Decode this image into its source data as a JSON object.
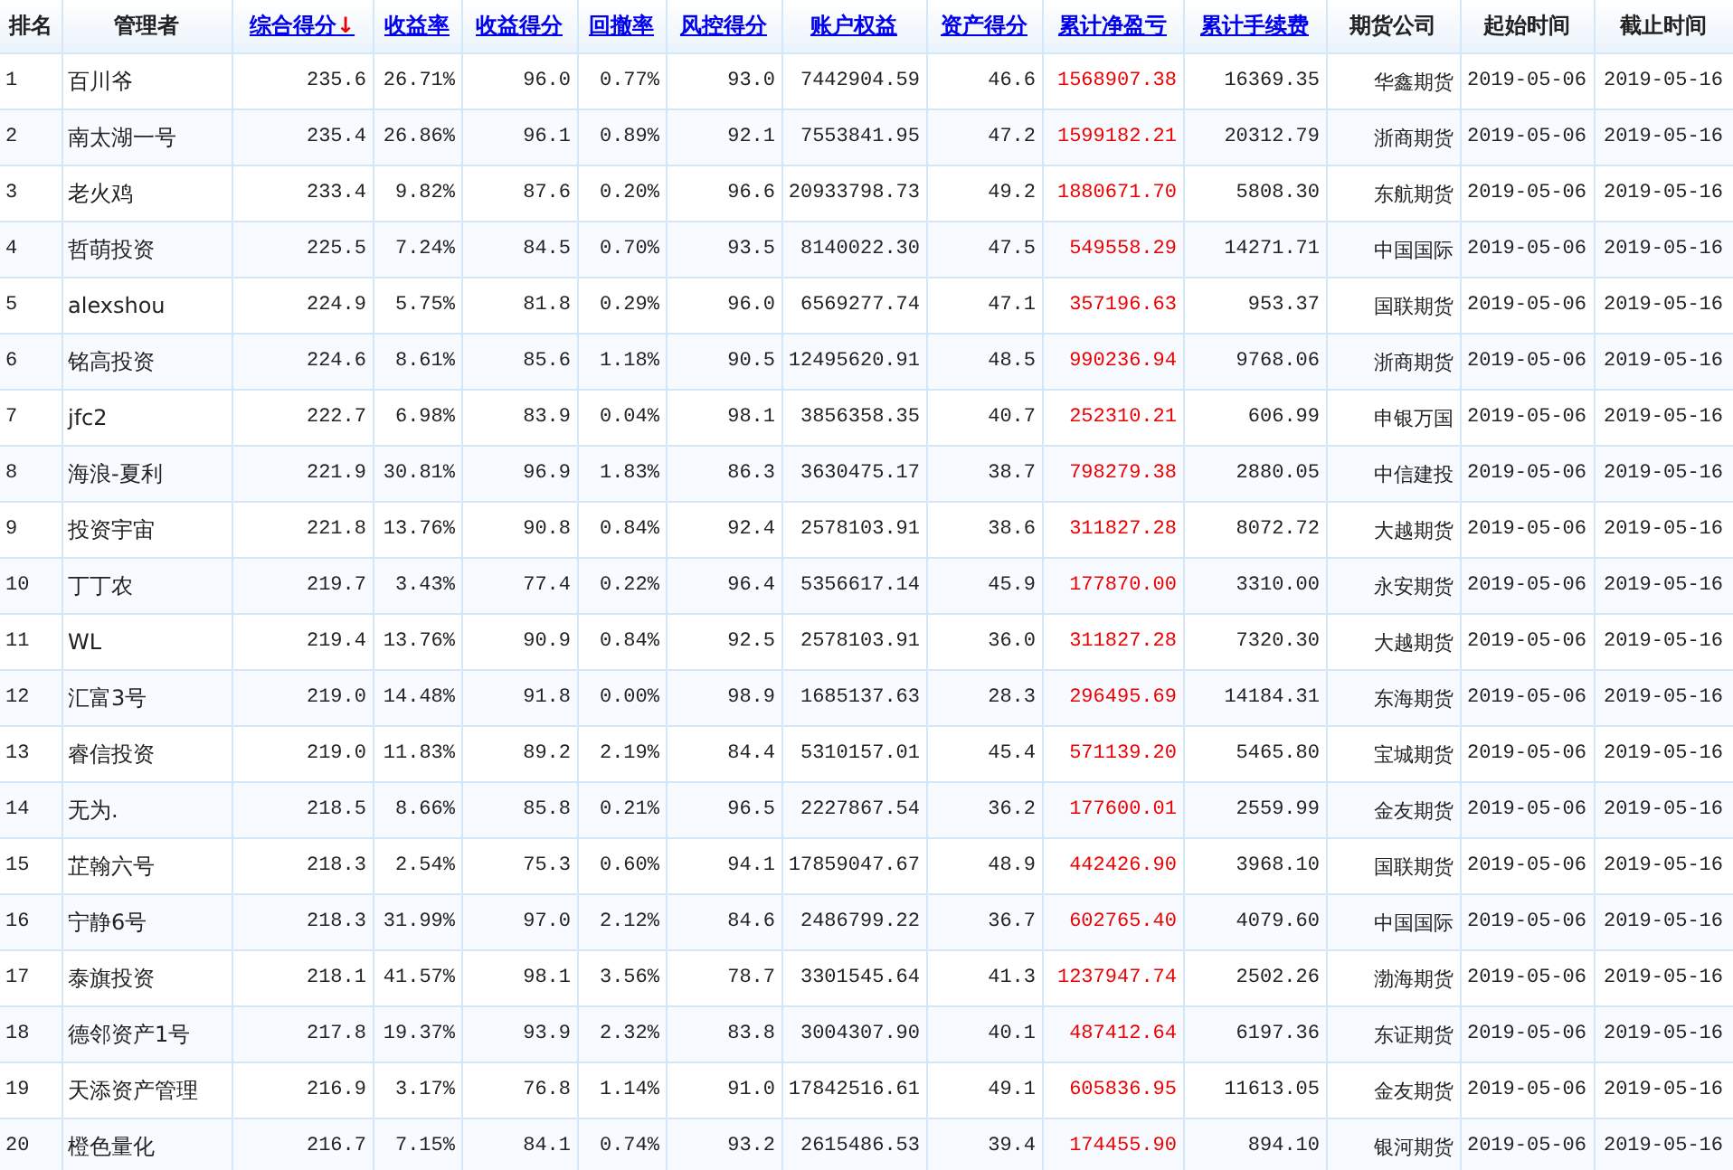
{
  "table": {
    "columns": [
      {
        "label": "排名",
        "link": false,
        "kind": "rank"
      },
      {
        "label": "管理者",
        "link": false,
        "kind": "text"
      },
      {
        "label": "综合得分",
        "link": true,
        "kind": "number",
        "sort_mark": "↓"
      },
      {
        "label": "收益率",
        "link": true,
        "kind": "number"
      },
      {
        "label": "收益得分",
        "link": true,
        "kind": "number"
      },
      {
        "label": "回撤率",
        "link": true,
        "kind": "number"
      },
      {
        "label": "风控得分",
        "link": true,
        "kind": "number"
      },
      {
        "label": "账户权益",
        "link": true,
        "kind": "number"
      },
      {
        "label": "资产得分",
        "link": true,
        "kind": "number"
      },
      {
        "label": "累计净盈亏",
        "link": true,
        "kind": "number",
        "emphasis": true
      },
      {
        "label": "累计手续费",
        "link": true,
        "kind": "number"
      },
      {
        "label": "期货公司",
        "link": false,
        "kind": "number"
      },
      {
        "label": "起始时间",
        "link": false,
        "kind": "date"
      },
      {
        "label": "截止时间",
        "link": false,
        "kind": "date"
      }
    ],
    "rows": [
      [
        "1",
        "百川爷",
        "235.6",
        "26.71%",
        "96.0",
        "0.77%",
        "93.0",
        "7442904.59",
        "46.6",
        "1568907.38",
        "16369.35",
        "华鑫期货",
        "2019-05-06",
        "2019-05-16"
      ],
      [
        "2",
        "南太湖一号",
        "235.4",
        "26.86%",
        "96.1",
        "0.89%",
        "92.1",
        "7553841.95",
        "47.2",
        "1599182.21",
        "20312.79",
        "浙商期货",
        "2019-05-06",
        "2019-05-16"
      ],
      [
        "3",
        "老火鸡",
        "233.4",
        "9.82%",
        "87.6",
        "0.20%",
        "96.6",
        "20933798.73",
        "49.2",
        "1880671.70",
        "5808.30",
        "东航期货",
        "2019-05-06",
        "2019-05-16"
      ],
      [
        "4",
        "哲萌投资",
        "225.5",
        "7.24%",
        "84.5",
        "0.70%",
        "93.5",
        "8140022.30",
        "47.5",
        "549558.29",
        "14271.71",
        "中国国际",
        "2019-05-06",
        "2019-05-16"
      ],
      [
        "5",
        "alexshou",
        "224.9",
        "5.75%",
        "81.8",
        "0.29%",
        "96.0",
        "6569277.74",
        "47.1",
        "357196.63",
        "953.37",
        "国联期货",
        "2019-05-06",
        "2019-05-16"
      ],
      [
        "6",
        "铭高投资",
        "224.6",
        "8.61%",
        "85.6",
        "1.18%",
        "90.5",
        "12495620.91",
        "48.5",
        "990236.94",
        "9768.06",
        "浙商期货",
        "2019-05-06",
        "2019-05-16"
      ],
      [
        "7",
        "jfc2",
        "222.7",
        "6.98%",
        "83.9",
        "0.04%",
        "98.1",
        "3856358.35",
        "40.7",
        "252310.21",
        "606.99",
        "申银万国",
        "2019-05-06",
        "2019-05-16"
      ],
      [
        "8",
        "海浪-夏利",
        "221.9",
        "30.81%",
        "96.9",
        "1.83%",
        "86.3",
        "3630475.17",
        "38.7",
        "798279.38",
        "2880.05",
        "中信建投",
        "2019-05-06",
        "2019-05-16"
      ],
      [
        "9",
        "投资宇宙",
        "221.8",
        "13.76%",
        "90.8",
        "0.84%",
        "92.4",
        "2578103.91",
        "38.6",
        "311827.28",
        "8072.72",
        "大越期货",
        "2019-05-06",
        "2019-05-16"
      ],
      [
        "10",
        "丁丁农",
        "219.7",
        "3.43%",
        "77.4",
        "0.22%",
        "96.4",
        "5356617.14",
        "45.9",
        "177870.00",
        "3310.00",
        "永安期货",
        "2019-05-06",
        "2019-05-16"
      ],
      [
        "11",
        "WL",
        "219.4",
        "13.76%",
        "90.9",
        "0.84%",
        "92.5",
        "2578103.91",
        "36.0",
        "311827.28",
        "7320.30",
        "大越期货",
        "2019-05-06",
        "2019-05-16"
      ],
      [
        "12",
        "汇富3号",
        "219.0",
        "14.48%",
        "91.8",
        "0.00%",
        "98.9",
        "1685137.63",
        "28.3",
        "296495.69",
        "14184.31",
        "东海期货",
        "2019-05-06",
        "2019-05-16"
      ],
      [
        "13",
        "睿信投资",
        "219.0",
        "11.83%",
        "89.2",
        "2.19%",
        "84.4",
        "5310157.01",
        "45.4",
        "571139.20",
        "5465.80",
        "宝城期货",
        "2019-05-06",
        "2019-05-16"
      ],
      [
        "14",
        "无为.",
        "218.5",
        "8.66%",
        "85.8",
        "0.21%",
        "96.5",
        "2227867.54",
        "36.2",
        "177600.01",
        "2559.99",
        "金友期货",
        "2019-05-06",
        "2019-05-16"
      ],
      [
        "15",
        "芷翰六号",
        "218.3",
        "2.54%",
        "75.3",
        "0.60%",
        "94.1",
        "17859047.67",
        "48.9",
        "442426.90",
        "3968.10",
        "国联期货",
        "2019-05-06",
        "2019-05-16"
      ],
      [
        "16",
        "宁静6号",
        "218.3",
        "31.99%",
        "97.0",
        "2.12%",
        "84.6",
        "2486799.22",
        "36.7",
        "602765.40",
        "4079.60",
        "中国国际",
        "2019-05-06",
        "2019-05-16"
      ],
      [
        "17",
        "泰旗投资",
        "218.1",
        "41.57%",
        "98.1",
        "3.56%",
        "78.7",
        "3301545.64",
        "41.3",
        "1237947.74",
        "2502.26",
        "渤海期货",
        "2019-05-06",
        "2019-05-16"
      ],
      [
        "18",
        "德邻资产1号",
        "217.8",
        "19.37%",
        "93.9",
        "2.32%",
        "83.8",
        "3004307.90",
        "40.1",
        "487412.64",
        "6197.36",
        "东证期货",
        "2019-05-06",
        "2019-05-16"
      ],
      [
        "19",
        "天添资产管理",
        "216.9",
        "3.17%",
        "76.8",
        "1.14%",
        "91.0",
        "17842516.61",
        "49.1",
        "605836.95",
        "11613.05",
        "金友期货",
        "2019-05-06",
        "2019-05-16"
      ],
      [
        "20",
        "橙色量化",
        "216.7",
        "7.15%",
        "84.1",
        "0.74%",
        "93.2",
        "2615486.53",
        "39.4",
        "174455.90",
        "894.10",
        "银河期货",
        "2019-05-06",
        "2019-05-16"
      ]
    ]
  }
}
